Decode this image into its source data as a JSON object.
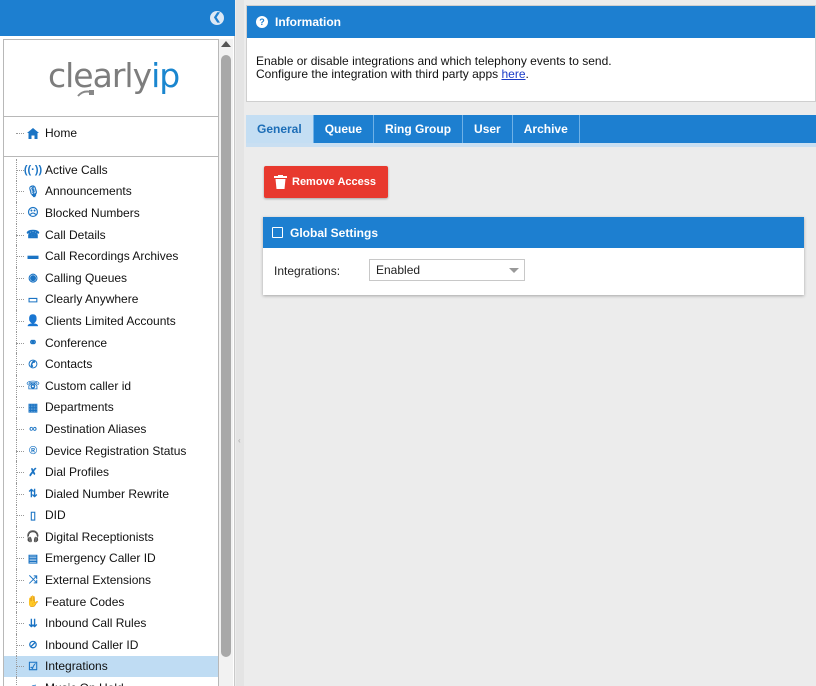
{
  "sidebar": {
    "logo": {
      "part1": "clearly",
      "part2": "ip"
    },
    "home_label": "Home",
    "items": [
      {
        "label": "Active Calls",
        "icon": "active-calls-icon",
        "glyph": "((·))"
      },
      {
        "label": "Announcements",
        "icon": "microphone-icon",
        "glyph": "🎙"
      },
      {
        "label": "Blocked Numbers",
        "icon": "blocked-face-icon",
        "glyph": "☹"
      },
      {
        "label": "Call Details",
        "icon": "phone-details-icon",
        "glyph": "☎"
      },
      {
        "label": "Call Recordings Archives",
        "icon": "archive-icon",
        "glyph": "▬"
      },
      {
        "label": "Calling Queues",
        "icon": "queue-icon",
        "glyph": "◉"
      },
      {
        "label": "Clearly Anywhere",
        "icon": "screen-icon",
        "glyph": "▭"
      },
      {
        "label": "Clients Limited Accounts",
        "icon": "user-lock-icon",
        "glyph": "👤"
      },
      {
        "label": "Conference",
        "icon": "handshake-icon",
        "glyph": "⚭"
      },
      {
        "label": "Contacts",
        "icon": "contact-phone-icon",
        "glyph": "✆"
      },
      {
        "label": "Custom caller id",
        "icon": "caller-id-icon",
        "glyph": "☏"
      },
      {
        "label": "Departments",
        "icon": "building-icon",
        "glyph": "▦"
      },
      {
        "label": "Destination Aliases",
        "icon": "link-icon",
        "glyph": "∞"
      },
      {
        "label": "Device Registration Status",
        "icon": "registered-icon",
        "glyph": "®"
      },
      {
        "label": "Dial Profiles",
        "icon": "phone-slash-icon",
        "glyph": "✗"
      },
      {
        "label": "Dialed Number Rewrite",
        "icon": "swap-arrows-icon",
        "glyph": "⇅"
      },
      {
        "label": "DID",
        "icon": "mobile-icon",
        "glyph": "▯"
      },
      {
        "label": "Digital Receptionists",
        "icon": "headset-icon",
        "glyph": "🎧"
      },
      {
        "label": "Emergency Caller ID",
        "icon": "id-card-icon",
        "glyph": "▤"
      },
      {
        "label": "External Extensions",
        "icon": "shuffle-icon",
        "glyph": "⤨"
      },
      {
        "label": "Feature Codes",
        "icon": "hand-coin-icon",
        "glyph": "✋"
      },
      {
        "label": "Inbound Call Rules",
        "icon": "sort-arrows-icon",
        "glyph": "⇊"
      },
      {
        "label": "Inbound Caller ID",
        "icon": "eye-slash-icon",
        "glyph": "⊘"
      },
      {
        "label": "Integrations",
        "icon": "calendar-check-icon",
        "glyph": "☑",
        "active": true
      },
      {
        "label": "Music On Hold",
        "icon": "music-icon",
        "glyph": "♫"
      }
    ]
  },
  "info": {
    "title": "Information",
    "line1": "Enable or disable integrations and which telephony events to send.",
    "line2_prefix": "Configure the integration with third party apps ",
    "line2_link": "here",
    "line2_suffix": "."
  },
  "tabs": [
    {
      "label": "General",
      "active": true
    },
    {
      "label": "Queue"
    },
    {
      "label": "Ring Group"
    },
    {
      "label": "User"
    },
    {
      "label": "Archive"
    }
  ],
  "remove_button_label": "Remove Access",
  "global_settings": {
    "title": "Global Settings",
    "integrations_label": "Integrations:",
    "integrations_value": "Enabled"
  },
  "colors": {
    "primary": "#1d7fd0",
    "danger": "#e8392e",
    "active_item": "#bfdcf3"
  }
}
